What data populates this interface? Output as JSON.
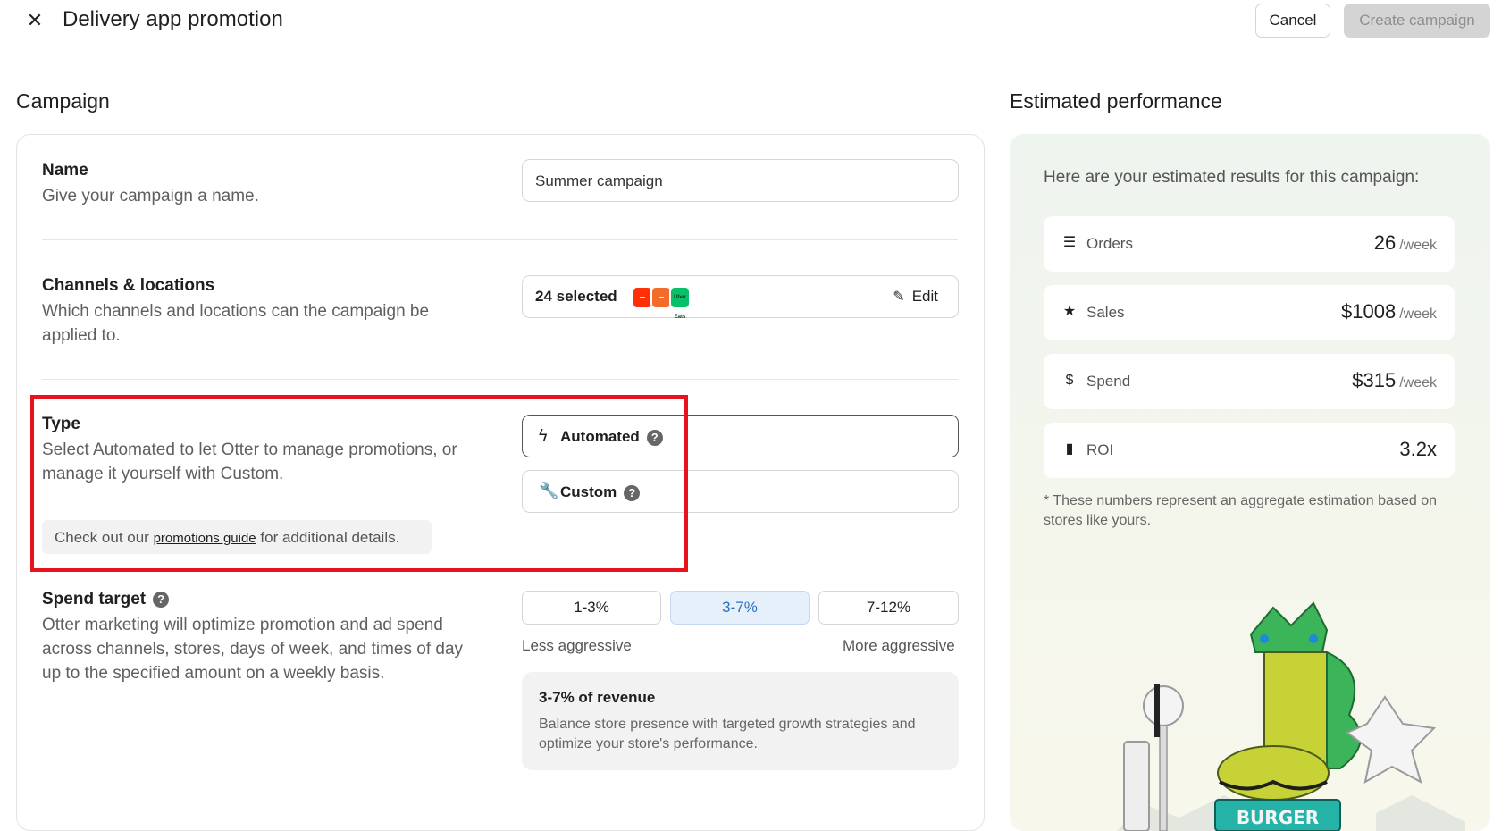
{
  "header": {
    "close_icon": "close-icon",
    "title": "Delivery app promotion",
    "cancel_label": "Cancel",
    "create_label": "Create campaign"
  },
  "campaign": {
    "heading": "Campaign",
    "name": {
      "title": "Name",
      "desc": "Give your campaign a name.",
      "value": "Summer campaign"
    },
    "channels": {
      "title": "Channels & locations",
      "desc": "Which channels and locations can the campaign be applied to.",
      "selected_text": "24 selected",
      "edit_label": "Edit",
      "logos": [
        "doordash",
        "grubhub",
        "uber-eats"
      ],
      "uber_logo_text": "Uber Eats"
    },
    "type": {
      "title": "Type",
      "desc": "Select Automated to let Otter to manage promotions, or manage it yourself with Custom.",
      "guide_prefix": "Check out our",
      "guide_link": "promotions guide",
      "guide_suffix": "for additional details.",
      "options": [
        {
          "label": "Automated",
          "icon": "lightning-icon",
          "selected": true
        },
        {
          "label": "Custom",
          "icon": "wrench-icon",
          "selected": false
        }
      ]
    },
    "spend": {
      "title": "Spend target",
      "desc": "Otter marketing will optimize promotion and ad spend across channels, stores, days of week, and times of day up to the specified amount on a weekly basis.",
      "options": [
        "1-3%",
        "3-7%",
        "7-12%"
      ],
      "selected": "3-7%",
      "less_label": "Less aggressive",
      "more_label": "More aggressive",
      "info_title": "3-7% of revenue",
      "info_desc": "Balance store presence with targeted growth strategies and optimize your store's performance."
    }
  },
  "performance": {
    "heading": "Estimated performance",
    "intro": "Here are your estimated results for this campaign:",
    "metrics": [
      {
        "label": "Orders",
        "value": "26",
        "unit": "/week",
        "icon": "orders-icon"
      },
      {
        "label": "Sales",
        "value": "$1008",
        "unit": "/week",
        "icon": "star-icon"
      },
      {
        "label": "Spend",
        "value": "$315",
        "unit": "/week",
        "icon": "dollar-icon"
      },
      {
        "label": "ROI",
        "value": "3.2x",
        "unit": "",
        "icon": "bar-chart-icon"
      }
    ],
    "footnote": "* These numbers represent an aggregate estimation based on stores like yours.",
    "illustration_text": "BURGER"
  },
  "colors": {
    "highlight": "#e8121a",
    "selected_seg_bg": "#e6f0fb",
    "selected_seg_text": "#2b6fc4",
    "doordash": "#ff3008",
    "grubhub": "#f26c2b",
    "ubereats": "#06c167"
  }
}
